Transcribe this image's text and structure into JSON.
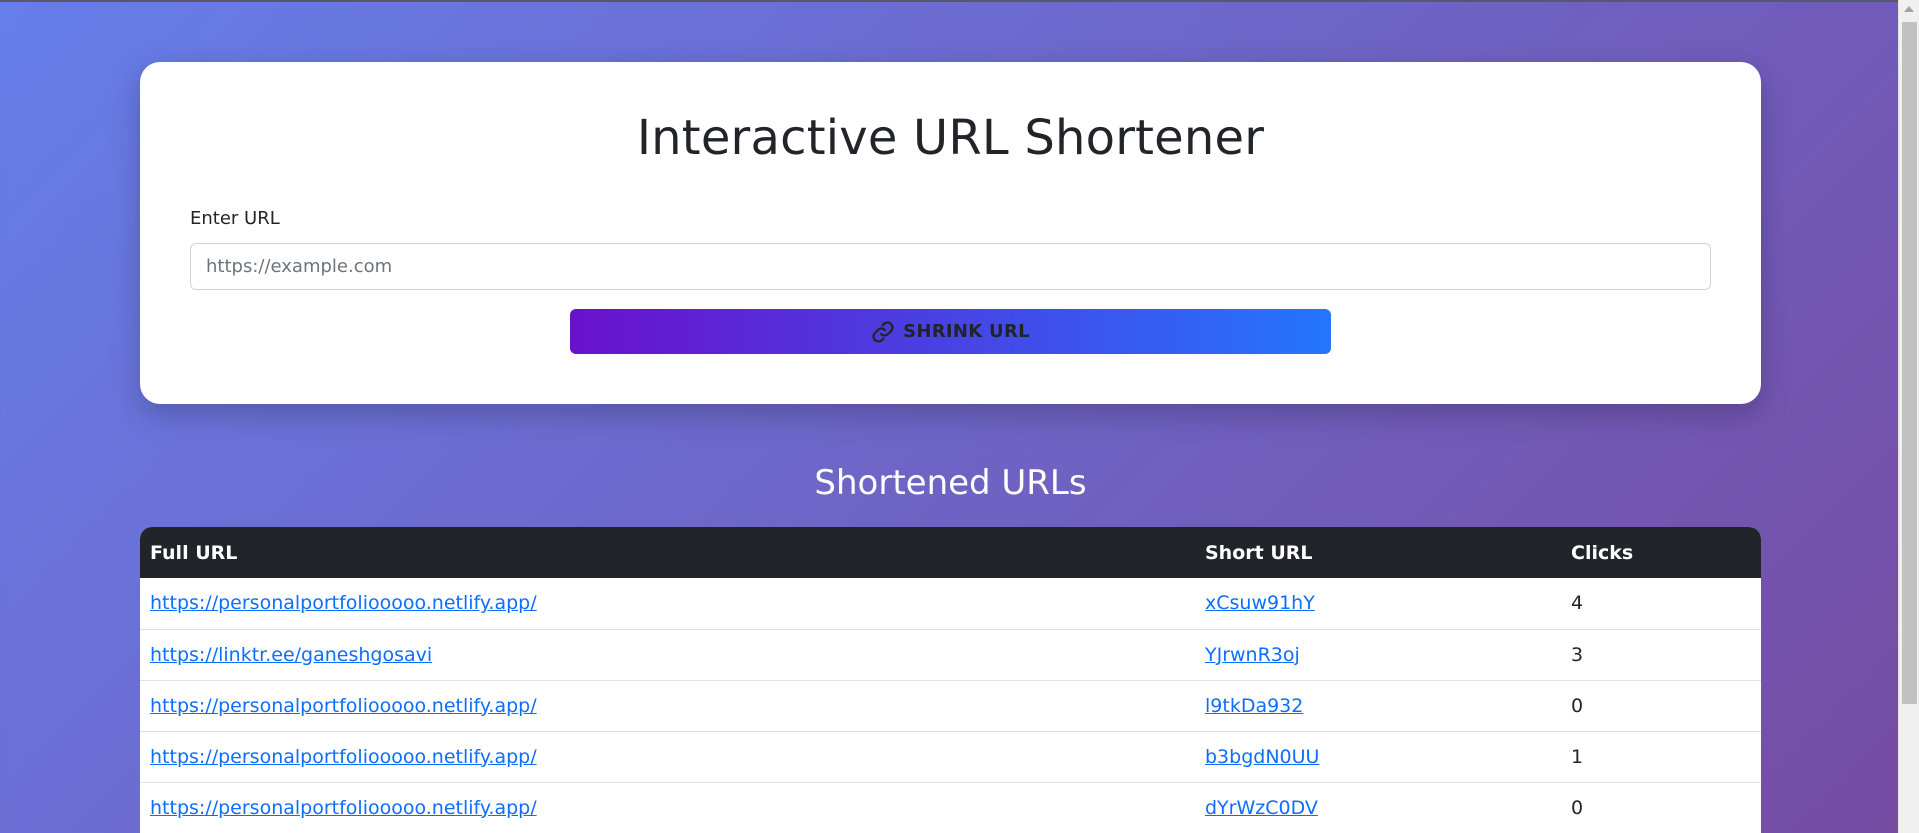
{
  "app": {
    "title": "Interactive URL Shortener"
  },
  "form": {
    "label": "Enter URL",
    "input_value": "",
    "input_placeholder": "https://example.com",
    "button_label": "SHRINK URL",
    "button_icon": "link-icon"
  },
  "results": {
    "title": "Shortened URLs",
    "columns": [
      "Full URL",
      "Short URL",
      "Clicks"
    ],
    "rows": [
      {
        "full_url": "https://personalportfoliooooo.netlify.app/",
        "short_url": "xCsuw91hY",
        "clicks": "4"
      },
      {
        "full_url": "https://linktr.ee/ganeshgosavi",
        "short_url": "YJrwnR3oj",
        "clicks": "3"
      },
      {
        "full_url": "https://personalportfoliooooo.netlify.app/",
        "short_url": "l9tkDa932",
        "clicks": "0"
      },
      {
        "full_url": "https://personalportfoliooooo.netlify.app/",
        "short_url": "b3bgdN0UU",
        "clicks": "1"
      },
      {
        "full_url": "https://personalportfoliooooo.netlify.app/",
        "short_url": "dYrWzC0DV",
        "clicks": "0"
      }
    ]
  },
  "colors": {
    "background_gradient_start": "#667eea",
    "background_gradient_end": "#764ba2",
    "button_gradient_start": "#6a11cb",
    "button_gradient_end": "#2575fc",
    "table_header": "#212529",
    "link": "#0d6efd"
  }
}
